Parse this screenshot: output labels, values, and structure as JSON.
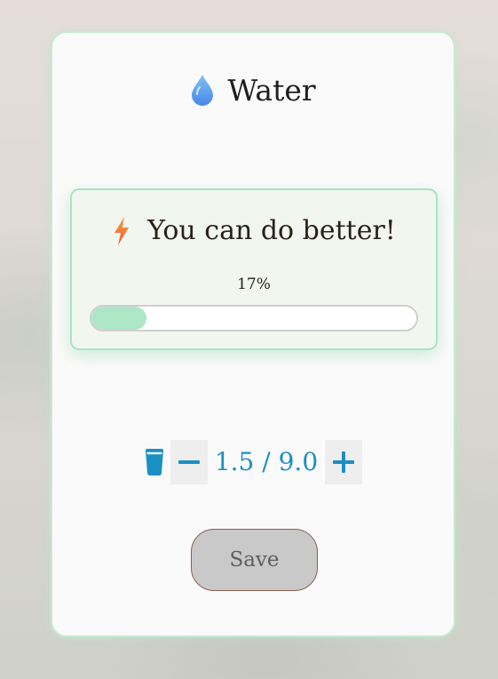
{
  "card": {
    "title": "Water",
    "title_icon": "water-drop-icon"
  },
  "status": {
    "icon": "lightning-bolt-icon",
    "message": "You can do better!",
    "percent_label": "17%",
    "progress_fraction": 0.17
  },
  "counter": {
    "icon": "water-glass-icon",
    "decrement_icon": "minus-icon",
    "increment_icon": "plus-icon",
    "value_text": "1.5 / 9.0",
    "accent_color": "#1a8fc4"
  },
  "actions": {
    "save_label": "Save"
  },
  "colors": {
    "progress_fill": "#aee7c6",
    "card_border": "#c6ead5",
    "status_border": "#a9e4c6"
  }
}
